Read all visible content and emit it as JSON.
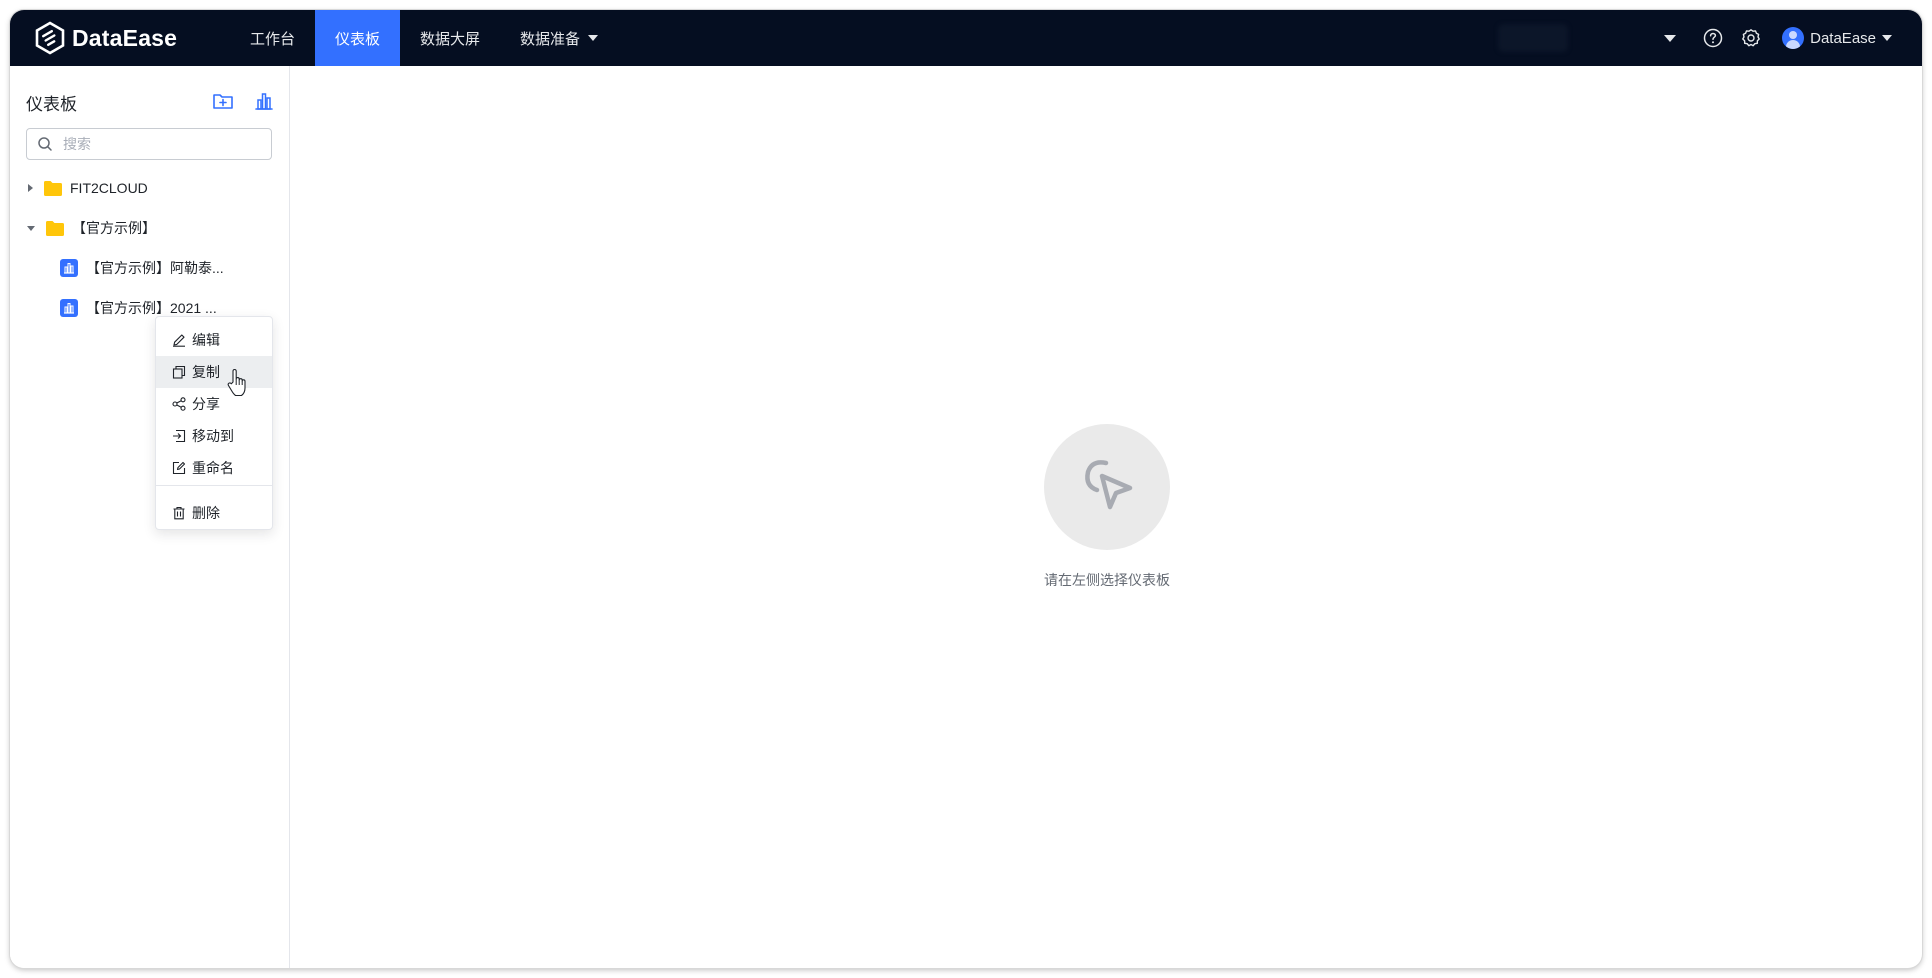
{
  "app": {
    "name": "DataEase"
  },
  "nav": {
    "items": [
      {
        "label": "工作台",
        "active": false,
        "has_caret": false
      },
      {
        "label": "仪表板",
        "active": true,
        "has_caret": false
      },
      {
        "label": "数据大屏",
        "active": false,
        "has_caret": false
      },
      {
        "label": "数据准备",
        "active": false,
        "has_caret": true
      }
    ]
  },
  "toolbar_right": {
    "icons": [
      "caret-down-icon",
      "help-icon",
      "gear-icon"
    ],
    "user_name": "DataEase"
  },
  "sidebar": {
    "title": "仪表板",
    "action_icons": [
      "new-folder-icon",
      "new-dashboard-icon"
    ],
    "search": {
      "placeholder": "搜索",
      "value": ""
    },
    "tree": [
      {
        "label": "FIT2CLOUD",
        "type": "folder",
        "expanded": false
      },
      {
        "label": "【官方示例】",
        "type": "folder",
        "expanded": true
      },
      {
        "label": "【官方示例】阿勒泰...",
        "type": "dashboard"
      },
      {
        "label": "【官方示例】2021 ...",
        "type": "dashboard"
      }
    ]
  },
  "context_menu": {
    "items": [
      {
        "label": "编辑",
        "icon": "edit-icon"
      },
      {
        "label": "复制",
        "icon": "copy-icon",
        "hovered": true
      },
      {
        "label": "分享",
        "icon": "share-icon"
      },
      {
        "label": "移动到",
        "icon": "move-icon"
      },
      {
        "label": "重命名",
        "icon": "rename-icon"
      },
      {
        "label": "删除",
        "icon": "delete-icon"
      }
    ]
  },
  "main": {
    "empty_icon": "cursor-pointer-icon",
    "empty_text": "请在左侧选择仪表板"
  },
  "colors": {
    "topbar": "#050e21",
    "accent": "#3370ff",
    "folder": "#ffc60a"
  }
}
